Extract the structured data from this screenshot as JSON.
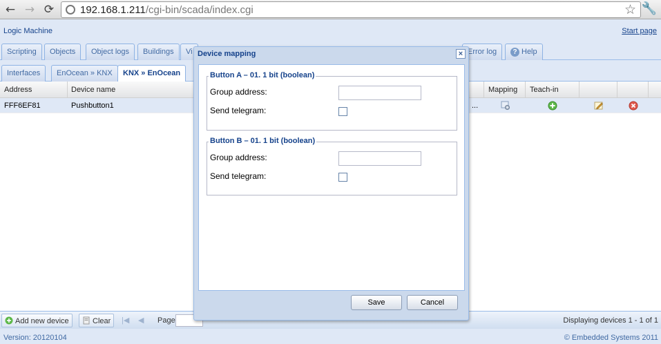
{
  "browser": {
    "url_host": "192.168.1.211",
    "url_path": "/cgi-bin/scada/index.cgi"
  },
  "app": {
    "title": "Logic Machine",
    "start_page": "Start page"
  },
  "tabs_main": [
    {
      "label": "Scripting"
    },
    {
      "label": "Objects"
    },
    {
      "label": "Object logs"
    },
    {
      "label": "Buildings"
    },
    {
      "label": "Vi"
    },
    {
      "label": "Error log"
    },
    {
      "label": "Help"
    }
  ],
  "tabs_sub": [
    {
      "label": "Interfaces"
    },
    {
      "label": "EnOcean » KNX"
    },
    {
      "label": "KNX » EnOcean"
    }
  ],
  "grid": {
    "columns": [
      "Address",
      "Device name",
      "Mapping",
      "Teach-in"
    ],
    "rows": [
      {
        "address": "FFF6EF81",
        "device_name": "Pushbutton1",
        "more": "..."
      }
    ]
  },
  "toolbar": {
    "add_new_device": "Add new device",
    "clear": "Clear",
    "page_label": "Page",
    "displaying": "Displaying devices 1 - 1 of 1"
  },
  "status": {
    "version": "Version: 20120104",
    "copyright": "© Embedded Systems 2011"
  },
  "dialog": {
    "title": "Device mapping",
    "sections": [
      {
        "legend": "Button A – 01. 1 bit (boolean)",
        "group_address_label": "Group address:",
        "group_address_value": "",
        "send_telegram_label": "Send telegram:",
        "send_telegram_checked": false
      },
      {
        "legend": "Button B – 01. 1 bit (boolean)",
        "group_address_label": "Group address:",
        "group_address_value": "",
        "send_telegram_label": "Send telegram:",
        "send_telegram_checked": false
      }
    ],
    "save_label": "Save",
    "cancel_label": "Cancel"
  },
  "colors": {
    "accent": "#15428b",
    "panel": "#dfe8f6",
    "dialog_frame": "#cbd9ec"
  }
}
